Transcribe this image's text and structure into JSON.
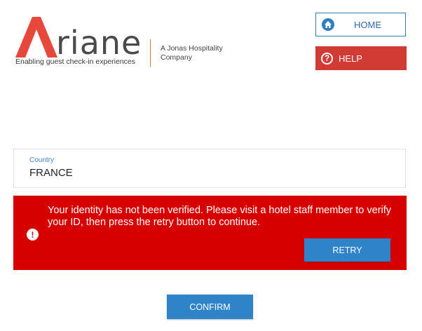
{
  "brand": {
    "wordmark_rest": "riane",
    "tagline": "Enabling guest check-in experiences",
    "company": "A Jonas Hospitality Company",
    "colors": {
      "brand_red": "#e8473c",
      "brand_orange": "#e07a3a"
    }
  },
  "header": {
    "home_label": "HOME",
    "home_icon": "home-icon",
    "help_label": "HELP",
    "help_icon": "question-circle-icon"
  },
  "form": {
    "country_label": "Country",
    "country_value": "FRANCE"
  },
  "error": {
    "icon": "exclamation-circle-icon",
    "message": "Your identity has not been verified. Please visit a hotel staff member to verify your ID, then press the retry button to continue.",
    "retry_label": "RETRY",
    "color": "#d60000"
  },
  "footer": {
    "confirm_label": "CONFIRM"
  }
}
